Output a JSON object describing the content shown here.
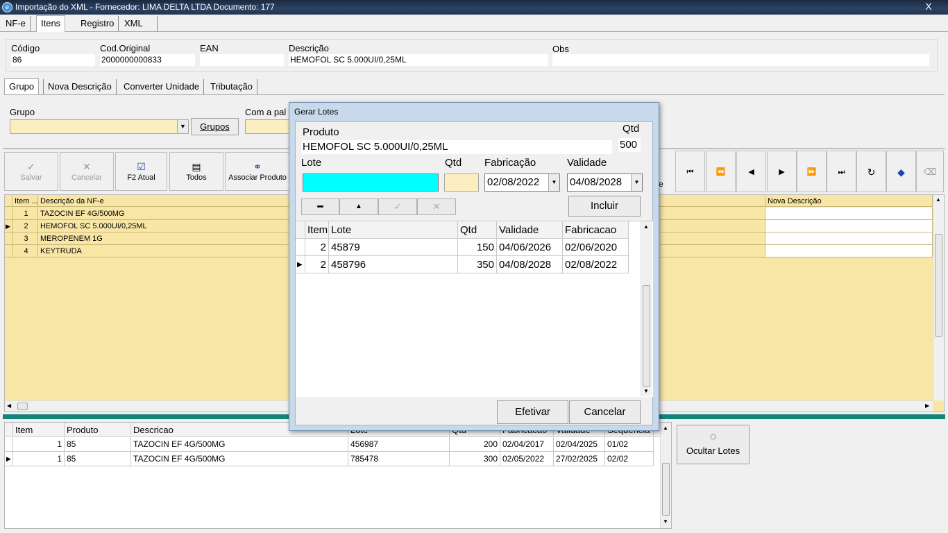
{
  "window": {
    "title": "Importação do XML - Fornecedor: LIMA DELTA LTDA Documento: 177",
    "close_label": "X"
  },
  "main_tabs": [
    "NF-e",
    "Itens",
    "Registro",
    "XML"
  ],
  "product": {
    "codigo_label": "Código",
    "codigo": "86",
    "cod_original_label": "Cod.Original",
    "cod_original": "2000000000833",
    "ean_label": "EAN",
    "ean": "",
    "descricao_label": "Descrição",
    "descricao": "HEMOFOL SC 5.000UI/0,25ML",
    "obs_label": "Obs",
    "obs": ""
  },
  "sub_tabs": [
    "Grupo",
    "Nova Descrição",
    "Converter Unidade",
    "Tributação"
  ],
  "grupo": {
    "label": "Grupo",
    "value": "",
    "button": "Grupos",
    "com_label": "Com a pal"
  },
  "toolbar": {
    "salvar": "Salvar",
    "cancelar": "Cancelar",
    "f2": "F2 Atual",
    "todos": "Todos",
    "associar": "Associar Produto",
    "partial": "e"
  },
  "items_grid": {
    "headers": [
      "Item ...",
      "Descrição da NF-e",
      "Nova Descrição"
    ],
    "rows": [
      {
        "item": "1",
        "descricao": "TAZOCIN EF 4G/500MG"
      },
      {
        "item": "2",
        "descricao": "HEMOFOL SC 5.000UI/0,25ML"
      },
      {
        "item": "3",
        "descricao": "MEROPENEM 1G"
      },
      {
        "item": "4",
        "descricao": "KEYTRUDA"
      }
    ]
  },
  "lotes_grid": {
    "headers": [
      "Item",
      "Produto",
      "Descricao",
      "Lote",
      "Qtd",
      "Fabricacao",
      "Validade",
      "Sequencia"
    ],
    "rows": [
      {
        "item": "1",
        "produto": "85",
        "descricao": "TAZOCIN EF 4G/500MG",
        "lote": "456987",
        "qtd": "200",
        "fabricacao": "02/04/2017",
        "validade": "02/04/2025",
        "seq": "01/02"
      },
      {
        "item": "1",
        "produto": "85",
        "descricao": "TAZOCIN EF 4G/500MG",
        "lote": "785478",
        "qtd": "300",
        "fabricacao": "02/05/2022",
        "validade": "27/02/2025",
        "seq": "02/02"
      }
    ]
  },
  "ocultar_lotes": "Ocultar Lotes",
  "dialog": {
    "title": "Gerar Lotes",
    "produto_label": "Produto",
    "produto": "HEMOFOL SC 5.000UI/0,25ML",
    "qtd_label": "Qtd",
    "qtd": "500",
    "lote_label": "Lote",
    "lote": "",
    "qtd2_label": "Qtd",
    "qtd2": "",
    "fabricacao_label": "Fabricação",
    "fabricacao": "02/08/2022",
    "validade_label": "Validade",
    "validade": "04/08/2028",
    "incluir": "Incluir",
    "grid_headers": [
      "Item",
      "Lote",
      "Qtd",
      "Validade",
      "Fabricacao"
    ],
    "grid_rows": [
      {
        "item": "2",
        "lote": "45879",
        "qtd": "150",
        "validade": "04/06/2026",
        "fabricacao": "02/06/2020"
      },
      {
        "item": "2",
        "lote": "458796",
        "qtd": "350",
        "validade": "04/08/2028",
        "fabricacao": "02/08/2022"
      }
    ],
    "efetivar": "Efetivar",
    "cancelar": "Cancelar"
  },
  "colors": {
    "accent_bar": "#13847a",
    "grid_yellow": "#f8e6a6",
    "lote_field": "#00ffff",
    "qtd_field": "#fbeec0"
  }
}
